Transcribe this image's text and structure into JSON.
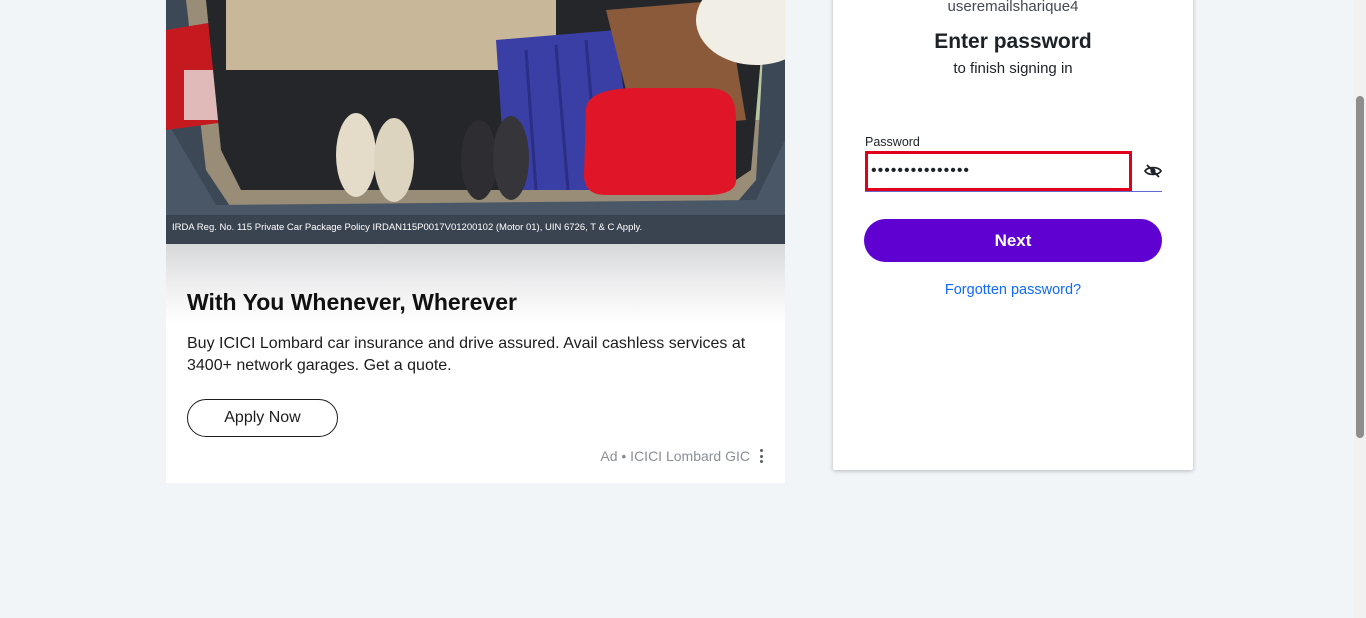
{
  "ad": {
    "disclaimer": "IRDA Reg. No. 115  Private Car Package Policy IRDAN115P0017V01200102 (Motor 01), UIN 6726, T & C Apply.",
    "headline": "With You Whenever, Wherever",
    "body": "Buy ICICI Lombard car insurance and drive assured. Avail cashless services at 3400+ network garages. Get a quote.",
    "cta_label": "Apply Now",
    "attribution": "Ad • ICICI Lombard GIC",
    "menu_icon": "more-vertical-icon"
  },
  "login": {
    "username": "useremailsharique4",
    "heading": "Enter password",
    "subheading": "to finish signing in",
    "password_label": "Password",
    "password_value": "•••••••••••••••",
    "show_password_icon": "eye-slash-icon",
    "next_label": "Next",
    "forgot_label": "Forgotten password?"
  },
  "colors": {
    "page_background": "#f1f5f8",
    "primary_button": "#5f01d1",
    "link": "#0f69ff",
    "focus_outline": "#e0001b"
  }
}
